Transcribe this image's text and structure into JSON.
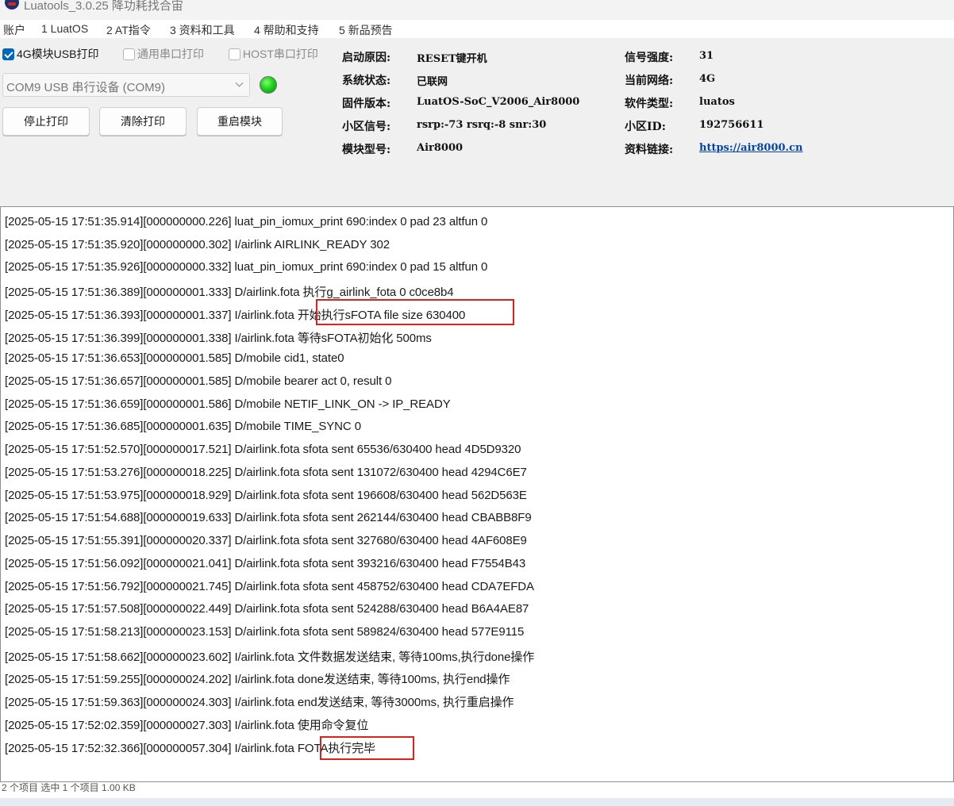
{
  "window": {
    "title": "Luatools_3.0.25 降功耗找合宙"
  },
  "menu": [
    "账户",
    "1 LuatOS",
    "2 AT指令",
    "3 资料和工具",
    "4 帮助和支持",
    "5 新品预告"
  ],
  "controls": {
    "checkboxes": [
      {
        "label": "4G模块USB打印",
        "checked": true
      },
      {
        "label": "通用串口打印",
        "checked": false
      },
      {
        "label": "HOST串口打印",
        "checked": false
      }
    ],
    "port_value": "COM9 USB 串行设备 (COM9)",
    "status_color": "#1ed31e",
    "buttons": {
      "stop_print": "停止打印",
      "clear_print": "清除打印",
      "restart_module": "重启模块"
    }
  },
  "info": {
    "boot_reason": {
      "label": "启动原因:",
      "value": "RESET键开机"
    },
    "system_status": {
      "label": "系统状态:",
      "value": "已联网"
    },
    "firmware_version": {
      "label": "固件版本:",
      "value": "LuatOS-SoC_V2006_Air8000"
    },
    "cell_signal": {
      "label": "小区信号:",
      "value": "rsrp:-73 rsrq:-8 snr:30"
    },
    "module_model": {
      "label": "模块型号:",
      "value": "Air8000"
    },
    "signal_strength": {
      "label": "信号强度:",
      "value": "31"
    },
    "current_network": {
      "label": "当前网络:",
      "value": "4G"
    },
    "software_type": {
      "label": "软件类型:",
      "value": "luatos"
    },
    "cell_id": {
      "label": "小区ID:",
      "value": "192756611"
    },
    "doc_link": {
      "label": "资料链接:",
      "value": "https://air8000.cn"
    }
  },
  "log": [
    "[2025-05-15 17:51:35.914][000000000.226] luat_pin_iomux_print 690:index 0 pad 23 altfun 0",
    "[2025-05-15 17:51:35.920][000000000.302] I/airlink AIRLINK_READY 302",
    "[2025-05-15 17:51:35.926][000000000.332] luat_pin_iomux_print 690:index 0 pad 15 altfun 0",
    "[2025-05-15 17:51:36.389][000000001.333] D/airlink.fota 执行g_airlink_fota 0 c0ce8b4",
    "[2025-05-15 17:51:36.393][000000001.337] I/airlink.fota 开始执行sFOTA file size 630400",
    "[2025-05-15 17:51:36.399][000000001.338] I/airlink.fota 等待sFOTA初始化 500ms",
    "[2025-05-15 17:51:36.653][000000001.585] D/mobile cid1, state0",
    "[2025-05-15 17:51:36.657][000000001.585] D/mobile bearer act 0, result 0",
    "[2025-05-15 17:51:36.659][000000001.586] D/mobile NETIF_LINK_ON -> IP_READY",
    "[2025-05-15 17:51:36.685][000000001.635] D/mobile TIME_SYNC 0",
    "[2025-05-15 17:51:52.570][000000017.521] D/airlink.fota sfota sent 65536/630400 head 4D5D9320",
    "[2025-05-15 17:51:53.276][000000018.225] D/airlink.fota sfota sent 131072/630400 head 4294C6E7",
    "[2025-05-15 17:51:53.975][000000018.929] D/airlink.fota sfota sent 196608/630400 head 562D563E",
    "[2025-05-15 17:51:54.688][000000019.633] D/airlink.fota sfota sent 262144/630400 head CBABB8F9",
    "[2025-05-15 17:51:55.391][000000020.337] D/airlink.fota sfota sent 327680/630400 head 4AF608E9",
    "[2025-05-15 17:51:56.092][000000021.041] D/airlink.fota sfota sent 393216/630400 head F7554B43",
    "[2025-05-15 17:51:56.792][000000021.745] D/airlink.fota sfota sent 458752/630400 head CDA7EFDA",
    "[2025-05-15 17:51:57.508][000000022.449] D/airlink.fota sfota sent 524288/630400 head B6A4AE87",
    "[2025-05-15 17:51:58.213][000000023.153] D/airlink.fota sfota sent 589824/630400 head 577E9115",
    "[2025-05-15 17:51:58.662][000000023.602] I/airlink.fota 文件数据发送结束, 等待100ms,执行done操作",
    "[2025-05-15 17:51:59.255][000000024.202] I/airlink.fota done发送结束, 等待100ms, 执行end操作",
    "[2025-05-15 17:51:59.363][000000024.303] I/airlink.fota end发送结束, 等待3000ms, 执行重启操作",
    "[2025-05-15 17:52:02.359][000000027.303] I/airlink.fota 使用命令复位",
    "[2025-05-15 17:52:32.366][000000057.304] I/airlink.fota FOTA执行完毕"
  ],
  "highlight_color": "#e0201b",
  "statusbar": {
    "text": "2 个项目    选中 1 个项目  1.00 KB"
  }
}
